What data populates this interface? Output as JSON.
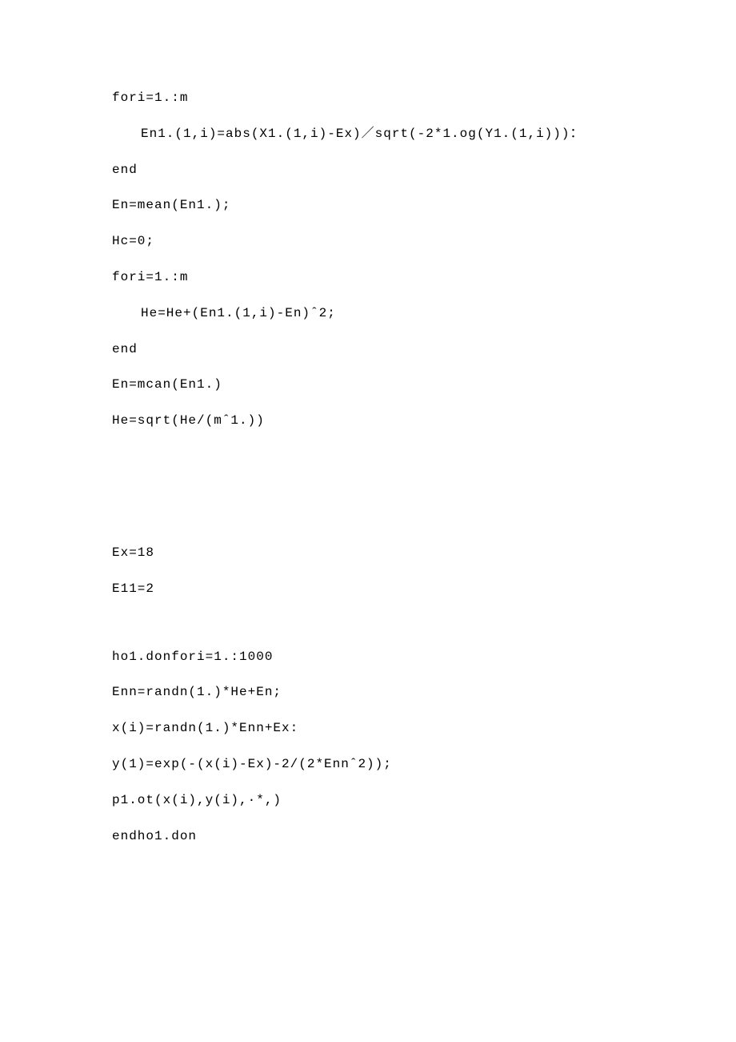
{
  "code": {
    "l1": "fori=1.:m",
    "l2": "En1.(1,i)=abs(X1.(1,i)-Ex)／sqrt(-2*1.og(Y1.(1,i)))：",
    "l3": "end",
    "l4": "En=mean(En1.);",
    "l5": "Hc=0;",
    "l6": "fori=1.:m",
    "l7": "He=He+(En1.(1,i)-En)ˆ2;",
    "l8": "end",
    "l9": "En=mcan(En1.)",
    "l10": "He=sqrt(He/(mˆ1.))",
    "l11": "Ex=18",
    "l12": "E11=2",
    "l13": "ho1.donfori=1.:1000",
    "l14": "Enn=randn(1.)*He+En;",
    "l15": "x(i)=randn(1.)*Enn+Ex:",
    "l16": "y(1)=exp(-(x(i)-Ex)-2/(2*Ennˆ2));",
    "l17": "p1.ot(x(i),y(i),·*,)",
    "l18": "endho1.don"
  }
}
